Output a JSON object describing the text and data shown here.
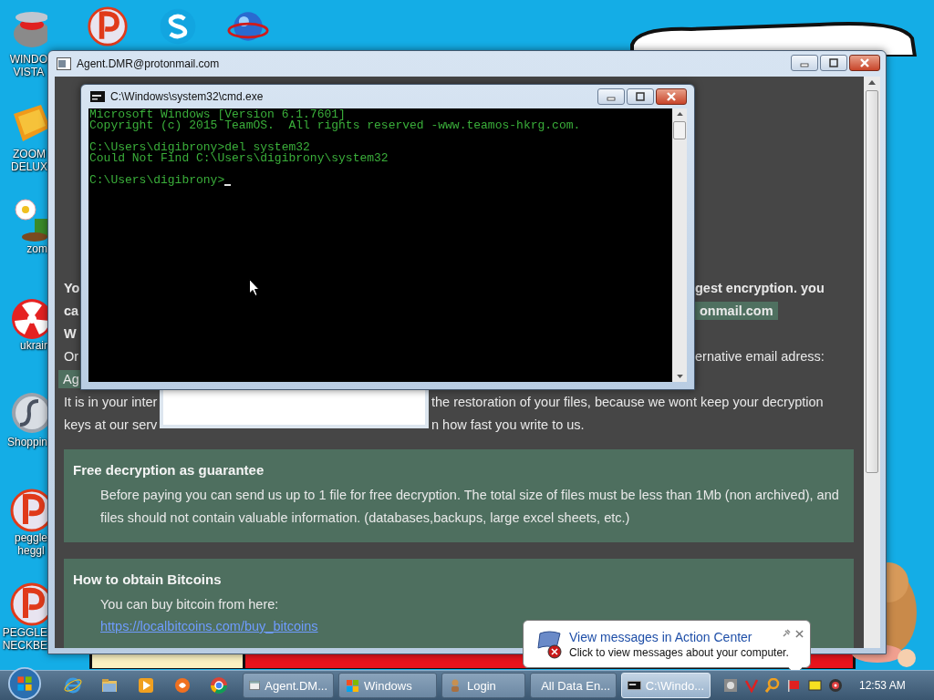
{
  "desktop_icons": [
    {
      "label": "WINDO\nVISTA",
      "kind": "bowl"
    },
    {
      "label": "ZOOM\nDELUX",
      "kind": "zoom"
    },
    {
      "label": "zom",
      "kind": "flower"
    },
    {
      "label": "ukrair",
      "kind": "radiation"
    },
    {
      "label": "Shoppin",
      "kind": "flash"
    },
    {
      "label": "peggle\nheggl",
      "kind": "peggle"
    },
    {
      "label": "PEGGLE\nNECKBE",
      "kind": "peggle"
    }
  ],
  "top_icons": [
    {
      "kind": "peggle"
    },
    {
      "kind": "skype"
    },
    {
      "kind": "globe"
    }
  ],
  "main_window": {
    "title": "Agent.DMR@protonmail.com",
    "note_lines": [
      {
        "left": "Yo",
        "right": "gest encryption. you",
        "bold": true,
        "highlight": false
      },
      {
        "left": "ca",
        "right": "onmail.com",
        "bold": true,
        "highlight": true
      },
      {
        "left": "W",
        "bold": true,
        "highlight": false
      },
      {
        "left": "Or",
        "right": "ernative email adress:",
        "bold": false,
        "highlight": false
      },
      {
        "left": "Ag",
        "bold": false,
        "highlight": true
      },
      {
        "left": "It is in your inter",
        "right": "the restoration of your files, because we wont keep your decryption",
        "bold": false,
        "highlight": false
      },
      {
        "left": "keys at our serv",
        "right": "n how fast you write to us.",
        "bold": false,
        "highlight": false
      }
    ],
    "panels": [
      {
        "heading": "Free decryption as guarantee",
        "text": "Before paying you can send us up to 1 file for free decryption. The total size of files must be less than 1Mb (non archived), and files should not contain valuable information. (databases,backups, large excel sheets, etc.)"
      },
      {
        "heading": "How to obtain Bitcoins",
        "text": "You can buy bitcoin from here:",
        "link": "https://localbitcoins.com/buy_bitcoins"
      }
    ]
  },
  "console_window": {
    "title": "C:\\Windows\\system32\\cmd.exe",
    "cursor": true,
    "lines": [
      {
        "text": "Microsoft Windows [Version 6.1.7601]",
        "gap_before": false
      },
      {
        "text": "Copyright (c) 2015 TeamOS.  All rights reserved -www.teamos-hkrg.com.",
        "gap_before": false
      },
      {
        "text": "C:\\Users\\digibrony>del system32",
        "gap_before": true
      },
      {
        "text": "Could Not Find C:\\Users\\digibrony\\system32",
        "gap_before": false
      },
      {
        "text": "C:\\Users\\digibrony>",
        "gap_before": true
      }
    ]
  },
  "notification": {
    "title": "View messages in Action Center",
    "text": "Click to view messages about your computer."
  },
  "taskbar": {
    "quick_launch": [
      {
        "kind": "ie"
      },
      {
        "kind": "folder"
      },
      {
        "kind": "media"
      },
      {
        "kind": "swirl"
      },
      {
        "kind": "chrome"
      }
    ],
    "tasks": [
      {
        "label": "Agent.DM...",
        "kind": "window",
        "selected": false
      },
      {
        "label": "Windows",
        "kind": "flag",
        "selected": false
      },
      {
        "label": "Login",
        "kind": "figure",
        "selected": false
      },
      {
        "label": "All Data En...",
        "kind": "window",
        "selected": false
      },
      {
        "label": "C:\\Windo...",
        "kind": "console",
        "selected": true
      }
    ],
    "tray": [
      {
        "kind": "app"
      },
      {
        "kind": "check"
      },
      {
        "kind": "magnifier"
      },
      {
        "kind": "flag"
      },
      {
        "kind": "note"
      },
      {
        "kind": "speaker"
      }
    ],
    "clock": "12:53 AM"
  }
}
